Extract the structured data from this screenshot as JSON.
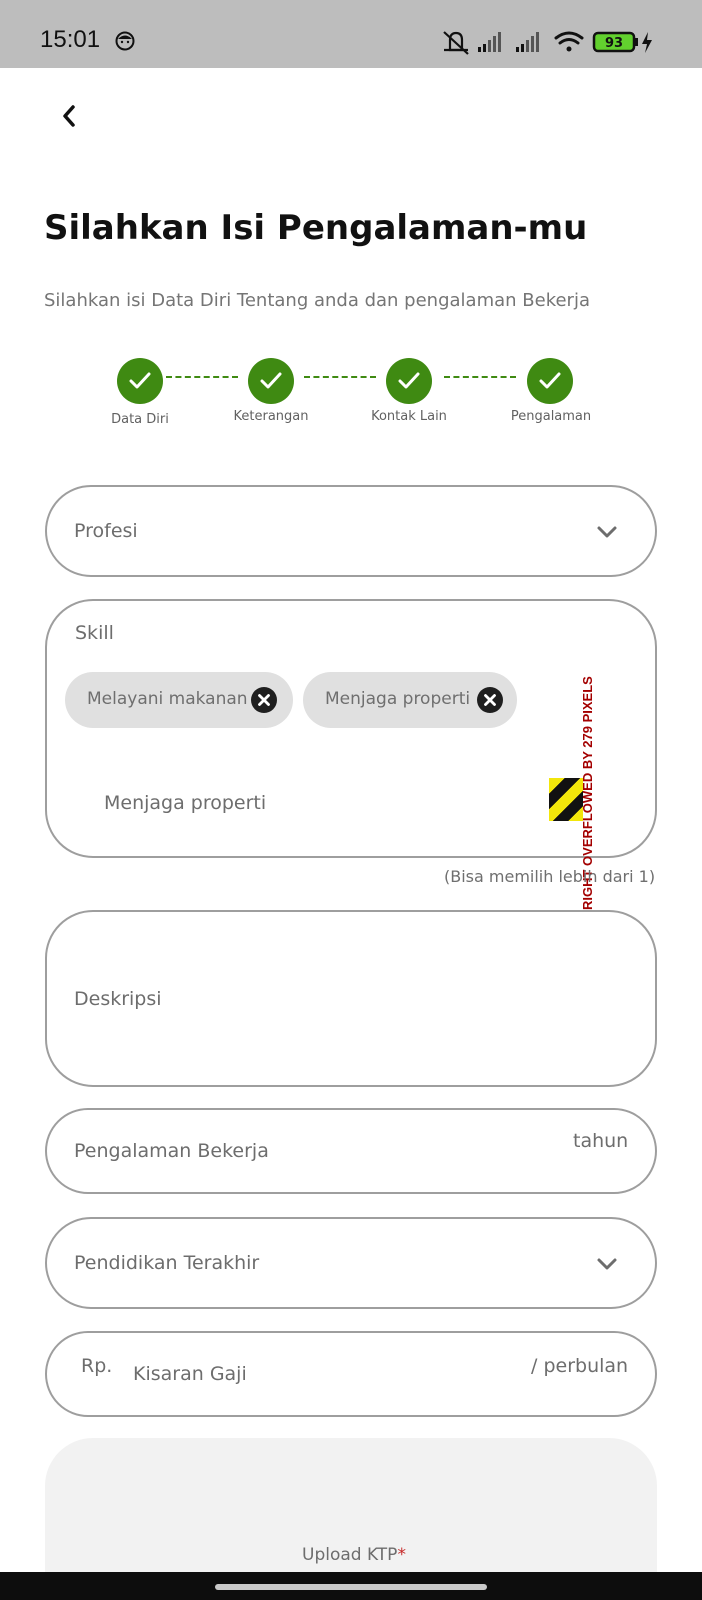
{
  "status_bar": {
    "time": "15:01",
    "battery": "93",
    "icons": [
      "face-icon",
      "mute-icon",
      "signal-icon",
      "signal-icon",
      "wifi-icon",
      "battery-icon",
      "charging-icon"
    ]
  },
  "header": {
    "back_icon": "back-chevron-icon",
    "title": "Silahkan Isi Pengalaman-mu",
    "subtitle": "Silahkan isi Data Diri Tentang anda dan pengalaman Bekerja"
  },
  "stepper": {
    "accent_color": "#3f8a12",
    "steps": [
      {
        "label": "Data Diri",
        "completed": true
      },
      {
        "label": "Keterangan",
        "completed": true
      },
      {
        "label": "Kontak Lain",
        "completed": true
      },
      {
        "label": "Pengalaman",
        "completed": true
      }
    ]
  },
  "form": {
    "profesi": {
      "label": "Profesi"
    },
    "skill": {
      "label": "Skill",
      "chips": [
        "Melayani makanan",
        "Menjaga properti"
      ],
      "input_value": "Menjaga properti",
      "helper": "(Bisa memilih lebih dari 1)",
      "overflow_warning": "RIGHT OVERFLOWED BY 279 PIXELS"
    },
    "deskripsi": {
      "label": "Deskripsi"
    },
    "pengalaman": {
      "label": "Pengalaman Bekerja",
      "suffix": "tahun"
    },
    "pendidikan": {
      "label": "Pendidikan Terakhir"
    },
    "gaji": {
      "prefix": "Rp.",
      "label": "Kisaran Gaji",
      "suffix": "/ perbulan"
    },
    "upload_ktp": {
      "label": "Upload KTP",
      "required_mark": "*"
    }
  }
}
